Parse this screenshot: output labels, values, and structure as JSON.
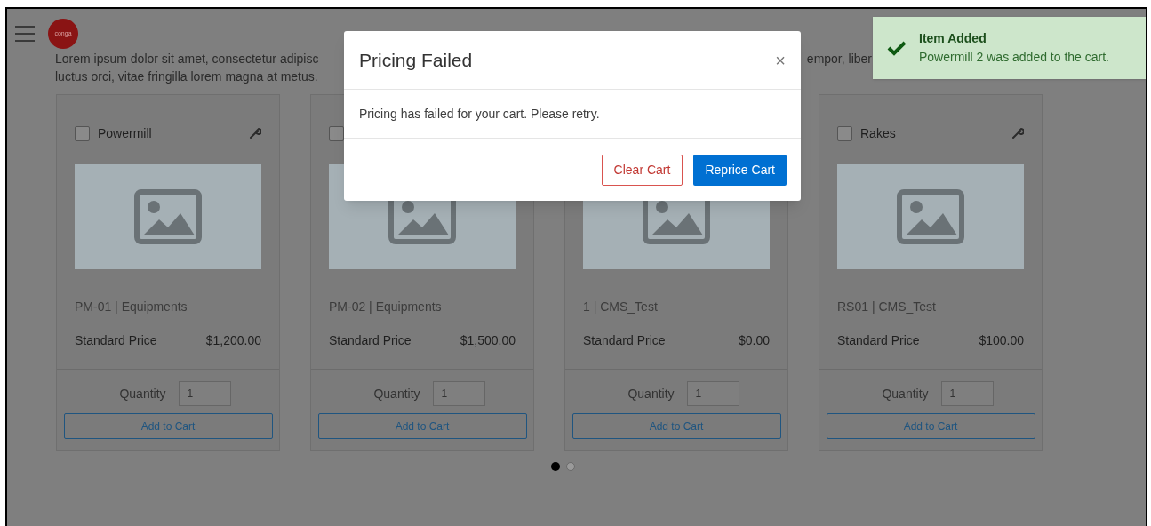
{
  "header": {
    "logo_text": "conga"
  },
  "description": {
    "line1_start": "Lorem ipsum dolor sit amet, consectetur adipisc",
    "line1_end": "empor, liber",
    "line2": "luctus orci, vitae fringilla lorem magna at metus."
  },
  "products": [
    {
      "name": "Powermill",
      "checked": false,
      "code": "PM-01 | Equipments",
      "price_label": "Standard Price",
      "price": "$1,200.00",
      "quantity_label": "Quantity",
      "quantity": "1",
      "button": "Add to Cart"
    },
    {
      "checked": false,
      "code": "PM-02 | Equipments",
      "price_label": "Standard Price",
      "price": "$1,500.00",
      "quantity_label": "Quantity",
      "quantity": "1",
      "button": "Add to Cart"
    },
    {
      "code": "1 | CMS_Test",
      "price_label": "Standard Price",
      "price": "$0.00",
      "quantity_label": "Quantity",
      "quantity": "1",
      "button": "Add to Cart"
    },
    {
      "name": "Rakes",
      "checked": false,
      "code": "RS01 | CMS_Test",
      "price_label": "Standard Price",
      "price": "$100.00",
      "quantity_label": "Quantity",
      "quantity": "1",
      "button": "Add to Cart"
    }
  ],
  "pagination": [
    {
      "selected": true
    },
    {
      "selected": false
    }
  ],
  "modal": {
    "title": "Pricing Failed",
    "close": "×",
    "message": "Pricing has failed for your cart. Please retry.",
    "buttons": [
      {
        "label": "Clear Cart",
        "kind": "outline"
      },
      {
        "label": "Reprice Cart",
        "kind": "primary"
      }
    ]
  },
  "toast": {
    "title": "Item Added",
    "message": "Powermill 2 was added to the cart."
  }
}
